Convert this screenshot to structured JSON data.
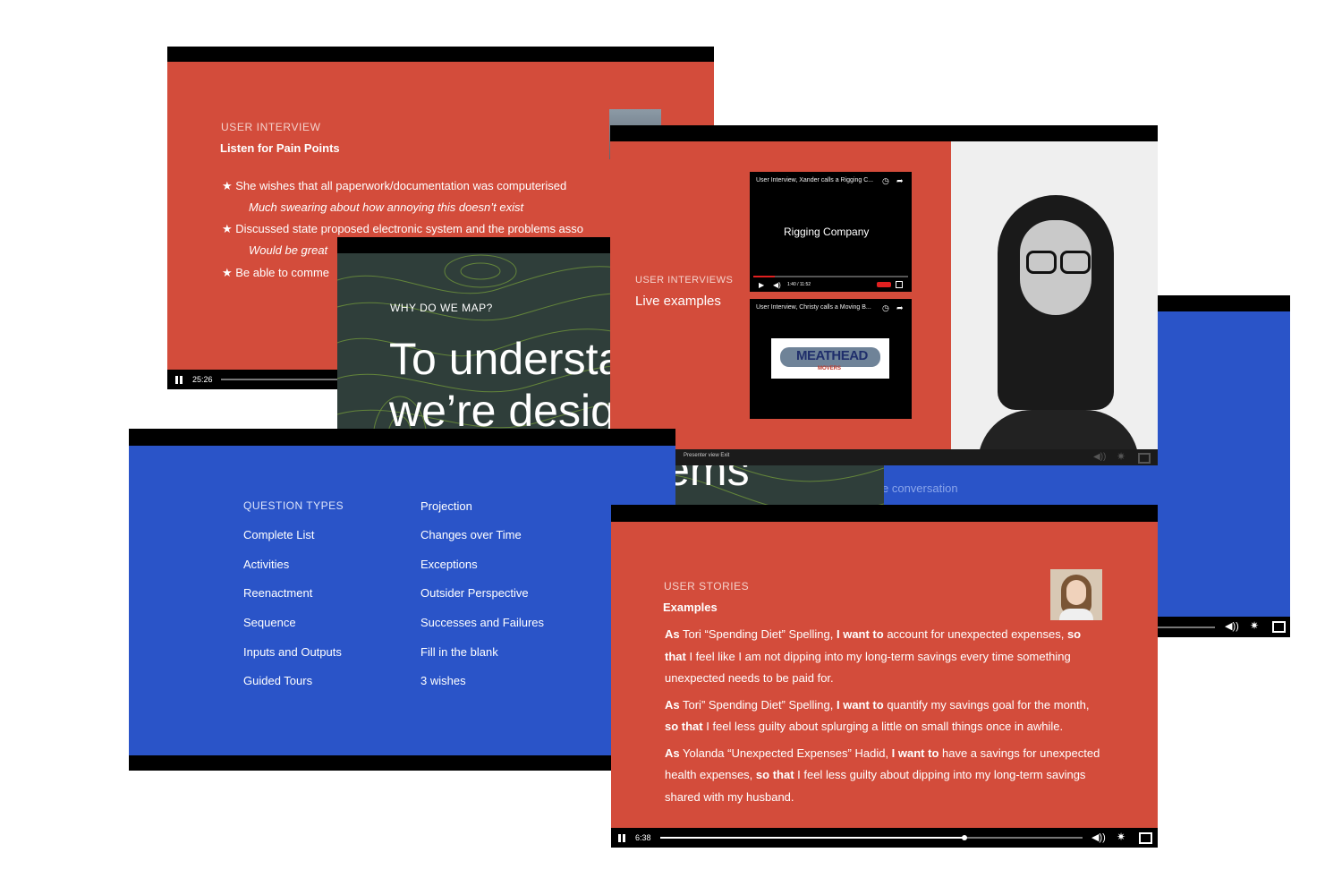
{
  "window_a": {
    "eyebrow": "USER INTERVIEW",
    "heading": "Listen for Pain Points",
    "bullets": [
      "★ She wishes that all paperwork/documentation was computerised",
      "Much swearing about how annoying this doesn’t exist",
      "★ Discussed state proposed electronic system and the problems asso",
      "Would be great",
      "★ Be able to comme"
    ],
    "time": "25:26"
  },
  "window_b": {
    "eyebrow": "WHY DO WE MAP?",
    "line1": "To understa",
    "line2": "we’re desig",
    "line3": "lems"
  },
  "window_c": {
    "eyebrow": "USER INTERVIEWS",
    "heading": "Live examples",
    "video1_title": "User Interview, Xander calls a Rigging C...",
    "video1_center": "Rigging Company",
    "video1_time": "1:40 / 11:52",
    "video2_title": "User Interview, Christy calls a Moving B...",
    "video2_logo": "MEATHEAD",
    "video2_logo_sub": "MOVERS",
    "presenter_bar": "Presenter view   Exit"
  },
  "window_d": {
    "partial_text": "e conversation"
  },
  "window_e": {
    "eyebrow": "QUESTION TYPES",
    "col1": [
      "Complete List",
      "Activities",
      "Reenactment",
      "Sequence",
      "Inputs and Outputs",
      "Guided Tours"
    ],
    "col2": [
      "Projection",
      "Changes over Time",
      "Exceptions",
      "Outsider Perspective",
      "Successes and Failures",
      "Fill in the blank",
      "3 wishes"
    ]
  },
  "window_f": {
    "eyebrow": "USER STORIES",
    "heading": "Examples",
    "time": "6:38",
    "progress": 0.72,
    "stories": [
      [
        [
          {
            "b": true,
            "t": "As"
          },
          {
            "b": false,
            "t": " Tori “Spending Diet” Spelling, "
          },
          {
            "b": true,
            "t": "I want to"
          },
          {
            "b": false,
            "t": " account for unexpected expenses, "
          },
          {
            "b": true,
            "t": "so"
          }
        ],
        [
          {
            "b": true,
            "t": "that"
          },
          {
            "b": false,
            "t": " I feel like I am not dipping into my long-term savings every time something"
          }
        ],
        [
          {
            "b": false,
            "t": "unexpected needs to be paid for."
          }
        ]
      ],
      [
        [
          {
            "b": true,
            "t": "As"
          },
          {
            "b": false,
            "t": " Tori” Spending Diet” Spelling, "
          },
          {
            "b": true,
            "t": "I want to"
          },
          {
            "b": false,
            "t": " quantify my savings goal for the month,"
          }
        ],
        [
          {
            "b": true,
            "t": "so that"
          },
          {
            "b": false,
            "t": " I feel less guilty about splurging a little on small things once in awhile."
          }
        ]
      ],
      [
        [
          {
            "b": true,
            "t": "As"
          },
          {
            "b": false,
            "t": " Yolanda “Unexpected Expenses” Hadid, "
          },
          {
            "b": true,
            "t": "I want to"
          },
          {
            "b": false,
            "t": " have a savings for unexpected"
          }
        ],
        [
          {
            "b": false,
            "t": "health expenses, "
          },
          {
            "b": true,
            "t": "so that"
          },
          {
            "b": false,
            "t": " I feel less guilty about dipping into my long-term savings"
          }
        ],
        [
          {
            "b": false,
            "t": "shared with my husband."
          }
        ]
      ]
    ]
  },
  "icons": {
    "volume": "volume-icon",
    "settings": "gear-icon",
    "fullscreen": "fullscreen-icon",
    "pause": "pause-icon"
  },
  "colors": {
    "red_slide": "#d34c3b",
    "blue_slide": "#2a54c8",
    "map_bg": "#2f3e3a",
    "contour": "#8fbf3a"
  }
}
